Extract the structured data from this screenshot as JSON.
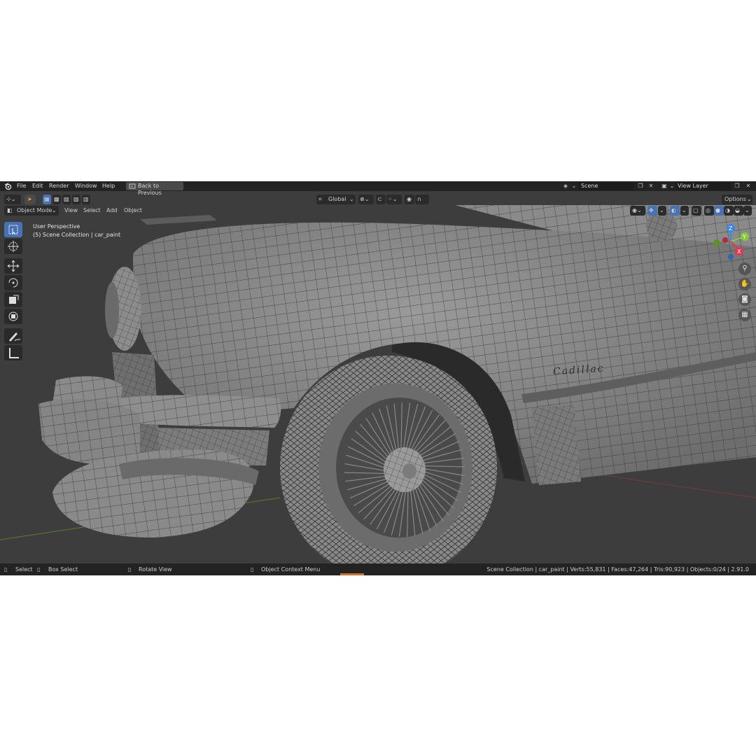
{
  "menu": {
    "items": [
      "File",
      "Edit",
      "Render",
      "Window",
      "Help"
    ],
    "back_button": "Back to Previous",
    "scene_field": "Scene",
    "view_layer_field": "View Layer"
  },
  "header": {
    "mode": "Object Mode",
    "menus": [
      "View",
      "Select",
      "Add",
      "Object"
    ],
    "orientation": "Global",
    "options": "Options"
  },
  "viewport": {
    "perspective": "User Perspective",
    "collection": "(5) Scene Collection | car_paint",
    "badge": "Cadillac",
    "gizmo": {
      "x": "X",
      "y": "Y",
      "z": "Z"
    }
  },
  "status": {
    "select": "Select",
    "box_select": "Box Select",
    "rotate_view": "Rotate View",
    "context_menu": "Object Context Menu",
    "stats": "Scene Collection | car_paint | Verts:55,831 | Faces:47,264 | Tris:90,923 | Objects:0/24 | 2.91.0"
  },
  "colors": {
    "accent": "#4772b3",
    "axis_x": "#e2384f",
    "axis_y": "#86c93a",
    "axis_z": "#3b86e6"
  }
}
